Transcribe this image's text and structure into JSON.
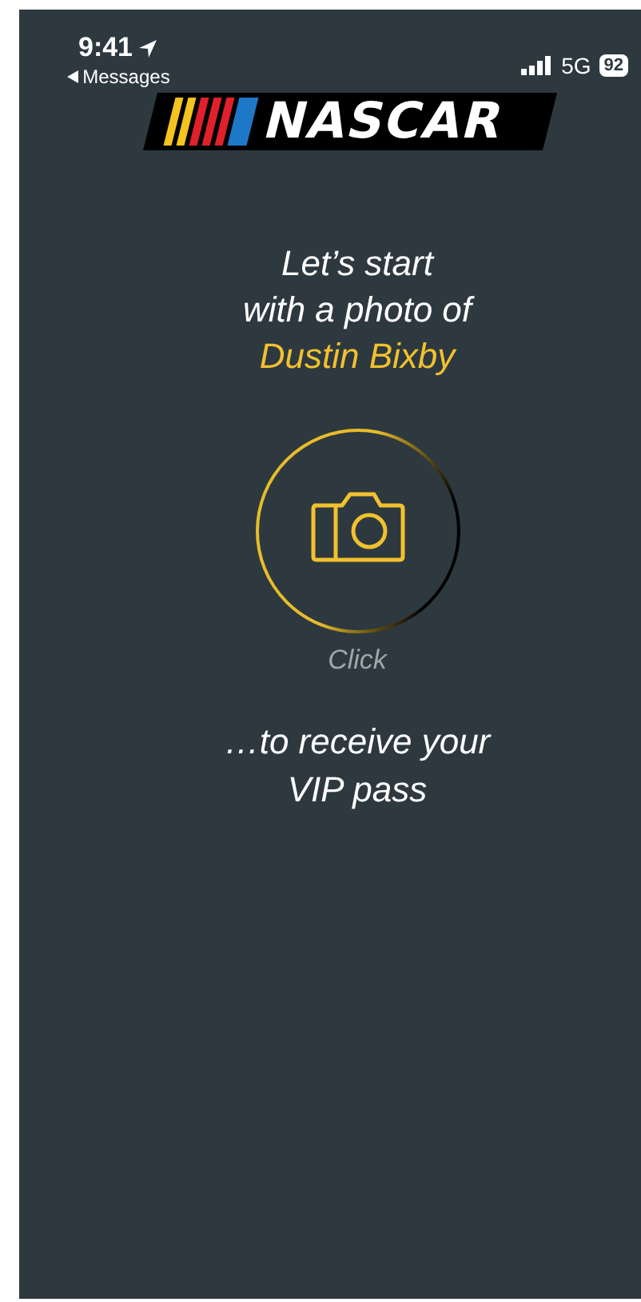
{
  "status_bar": {
    "time": "9:41",
    "back_label": "Messages",
    "network": "5G",
    "battery": "92"
  },
  "logo": {
    "text": "NASCAR"
  },
  "headline": {
    "lines": [
      "Let’s start",
      "with a photo of"
    ],
    "name": "Dustin Bixby"
  },
  "camera_button": {
    "label": "Click"
  },
  "footer": {
    "lines": [
      "…to receive your",
      "VIP pass"
    ]
  }
}
